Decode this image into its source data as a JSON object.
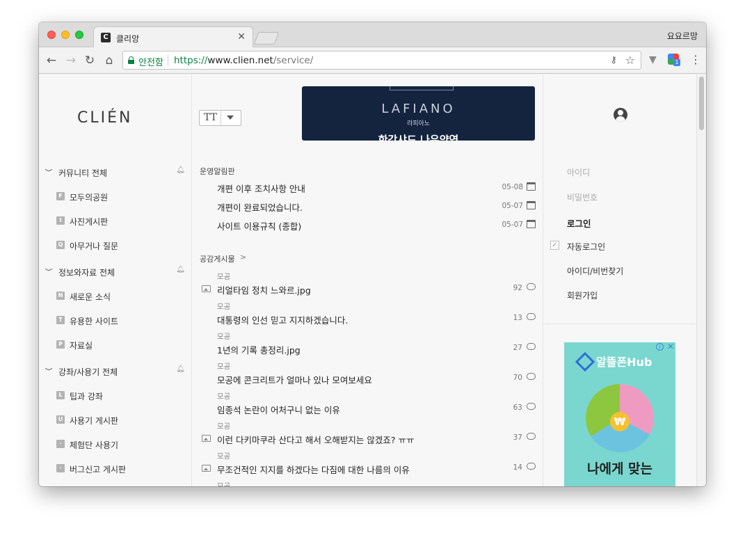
{
  "browser": {
    "tab_title": "클리앙",
    "tab_favicon": "C",
    "profile_name": "요요르망",
    "security_label": "안전함",
    "url_scheme": "https://",
    "url_host": "www.clien.net",
    "url_path": "/service/",
    "ext_badge": "1"
  },
  "site": {
    "logo": "CLIÉN"
  },
  "sidebar": {
    "categories": [
      {
        "label": "커뮤니티 전체",
        "boards": [
          {
            "badge": "F",
            "label": "모두의공원"
          },
          {
            "badge": "I",
            "label": "사진게시판"
          },
          {
            "badge": "Q",
            "label": "아무거나 질문"
          }
        ]
      },
      {
        "label": "정보와자료 전체",
        "boards": [
          {
            "badge": "N",
            "label": "새로운 소식"
          },
          {
            "badge": "T",
            "label": "유용한 사이트"
          },
          {
            "badge": "P",
            "label": "자료실"
          }
        ]
      },
      {
        "label": "강좌/사용기 전체",
        "boards": [
          {
            "badge": "L",
            "label": "팁과 강좌"
          },
          {
            "badge": "U",
            "label": "사용기 게시판"
          },
          {
            "badge": "·",
            "label": "체험단 사용기"
          },
          {
            "badge": "·",
            "label": "버그신고 게시판"
          }
        ]
      }
    ]
  },
  "banner": {
    "brand": "LAFIANO",
    "brand_ko": "라피아노",
    "slogan": "한강샤드 나유양역"
  },
  "font_control": {
    "label": "TT"
  },
  "notices": {
    "section_title": "운영알림판",
    "items": [
      {
        "title": "개편 이후 조치사항 안내",
        "date": "05-08"
      },
      {
        "title": "개편이 완료되었습니다.",
        "date": "05-07"
      },
      {
        "title": "사이트 이용규칙 (종합)",
        "date": "05-07"
      }
    ]
  },
  "popular": {
    "section_title": "공감게시물",
    "arrow": ">",
    "posts": [
      {
        "board": "모공",
        "title": "리얼타임 정치 느와르.jpg",
        "count": "92",
        "has_image": true
      },
      {
        "board": "모공",
        "title": "대통령의 인선 믿고 지지하겠습니다.",
        "count": "13",
        "has_image": false
      },
      {
        "board": "모공",
        "title": "1년의 기록 총정리.jpg",
        "count": "27",
        "has_image": false
      },
      {
        "board": "모공",
        "title": "모공에 콘크리트가 얼마나 있나 모여보세요",
        "count": "70",
        "has_image": false
      },
      {
        "board": "모공",
        "title": "임종석 논란이 어처구니 없는 이유",
        "count": "63",
        "has_image": false
      },
      {
        "board": "모공",
        "title": "이런 다키마쿠라 산다고 해서 오해받지는 않겠죠? ㅠㅠ",
        "count": "37",
        "has_image": true
      },
      {
        "board": "모공",
        "title": "무조건적인 지지를 하겠다는 다짐에 대한 나름의 이유",
        "count": "14",
        "has_image": true
      },
      {
        "board": "모공",
        "title": "",
        "count": "",
        "has_image": false
      }
    ]
  },
  "login": {
    "id_placeholder": "아이디",
    "pw_placeholder": "비밀번호",
    "login_label": "로그인",
    "auto_login_label": "자동로그인",
    "find_label": "아이디/비번찾기",
    "signup_label": "회원가입"
  },
  "ad": {
    "logo": "알뜰폰Hub",
    "info": "i",
    "close": "✕",
    "currency": "₩",
    "headline": "나에게 맞는"
  }
}
